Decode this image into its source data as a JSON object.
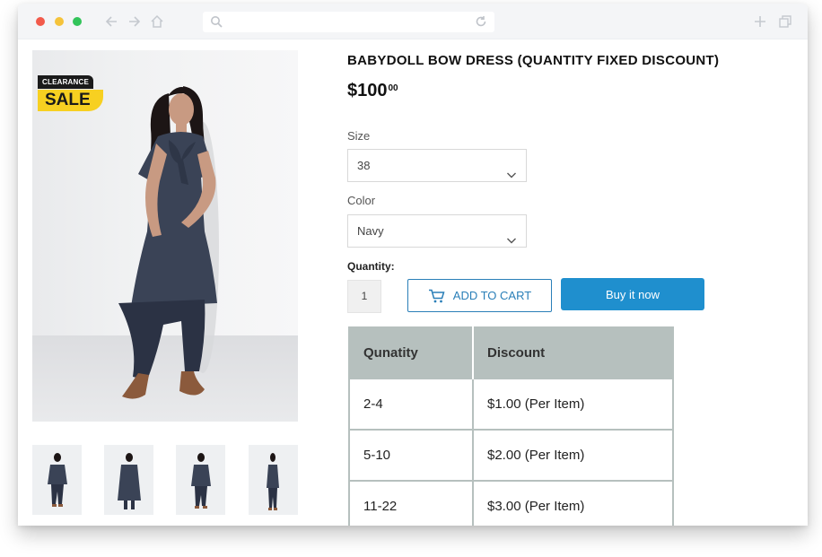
{
  "browser": {
    "url": ""
  },
  "badges": {
    "clearance": "CLEARANCE",
    "sale": "SALE"
  },
  "product": {
    "title": "BABYDOLL BOW DRESS (QUANTITY FIXED DISCOUNT)",
    "price_main": "$100",
    "price_cents": "00"
  },
  "options": {
    "size_label": "Size",
    "size_value": "38",
    "color_label": "Color",
    "color_value": "Navy"
  },
  "quantity": {
    "label": "Quantity:",
    "value": "1"
  },
  "buttons": {
    "add_to_cart": "ADD TO CART",
    "buy_now": "Buy it now"
  },
  "discount_table": {
    "headers": [
      "Qunatity",
      "Discount"
    ],
    "rows": [
      [
        "2-4",
        "$1.00 (Per Item)"
      ],
      [
        "5-10",
        "$2.00 (Per Item)"
      ],
      [
        "11-22",
        "$3.00 (Per Item)"
      ]
    ]
  },
  "colors": {
    "accent": "#1f8fce",
    "sale_yellow": "#f7d021",
    "table_header": "#b6c0be"
  },
  "icons": {
    "window_controls": [
      "close-dot",
      "minimize-dot",
      "maximize-dot"
    ],
    "nav": [
      "back-arrow-icon",
      "forward-arrow-icon",
      "home-icon"
    ],
    "url": [
      "search-icon",
      "reload-icon"
    ],
    "right": [
      "new-tab-icon",
      "copy-window-icon"
    ],
    "cart": "cart-icon",
    "select": "chevron-down-icon"
  }
}
